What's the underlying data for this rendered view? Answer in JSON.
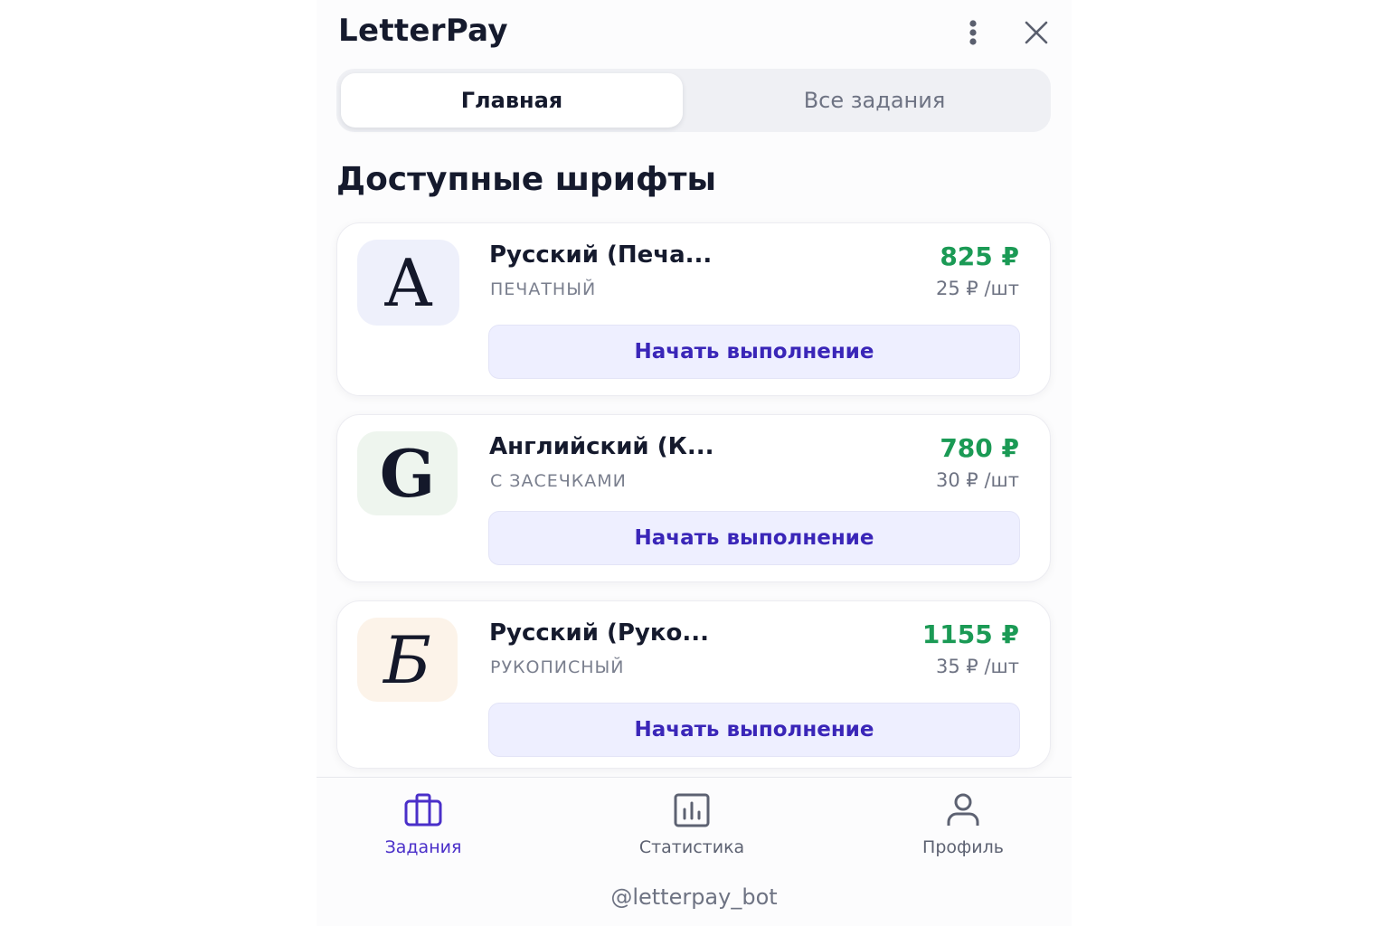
{
  "app": {
    "title": "LetterPay"
  },
  "tabs": [
    {
      "label": "Главная"
    },
    {
      "label": "Все задания"
    }
  ],
  "section": {
    "title": "Доступные шрифты"
  },
  "fonts": [
    {
      "glyph": "A",
      "title": "Русский (Печа...",
      "subtitle": "ПЕЧАТНЫЙ",
      "price": "825 ₽",
      "rate": "25 ₽ /шт",
      "button": "Начать выполнение",
      "icon_bg": "#eef0fb"
    },
    {
      "glyph": "G",
      "title": "Английский (К...",
      "subtitle": "С ЗАСЕЧКАМИ",
      "price": "780 ₽",
      "rate": "30 ₽ /шт",
      "button": "Начать выполнение",
      "icon_bg": "#eef5ee"
    },
    {
      "glyph": "Б",
      "title": "Русский (Руко...",
      "subtitle": "РУКОПИСНЫЙ",
      "price": "1155 ₽",
      "rate": "35 ₽ /шт",
      "button": "Начать выполнение",
      "icon_bg": "#fcf3e9"
    }
  ],
  "nav": [
    {
      "label": "Задания",
      "icon": "briefcase-icon",
      "active": true
    },
    {
      "label": "Статистика",
      "icon": "bar-chart-icon",
      "active": false
    },
    {
      "label": "Профиль",
      "icon": "user-icon",
      "active": false
    }
  ],
  "footer": {
    "handle": "@letterpay_bot"
  },
  "colors": {
    "accent": "#4a2fc9",
    "price_green": "#1b9a55",
    "button_bg": "#eeefff"
  }
}
